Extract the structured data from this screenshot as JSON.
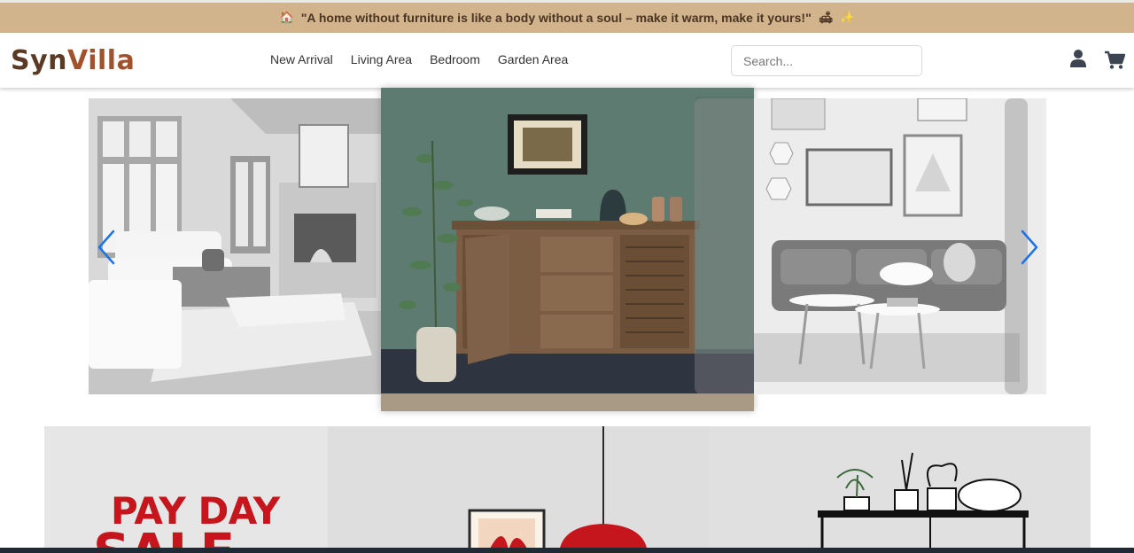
{
  "promo": {
    "house_emoji": "🏠",
    "text": "\"A home without furniture is like a body without a soul – make it warm, make it yours!\"",
    "couch_emoji": "🛋",
    "sparkle_emoji": "✨"
  },
  "brand": {
    "part1": "Syn",
    "part2": "Villa",
    "color_dark": "#5a3a25",
    "color_accent": "#a0522d"
  },
  "nav": {
    "items": [
      "New Arrival",
      "Living Area",
      "Bedroom",
      "Garden Area"
    ]
  },
  "search": {
    "placeholder": "Search...",
    "value": ""
  },
  "icons": {
    "user": "user-icon",
    "cart": "cart-icon",
    "prev": "chevron-left-icon",
    "next": "chevron-right-icon"
  },
  "carousel": {
    "slides": [
      "living-room-fireplace",
      "wooden-sideboard",
      "gallery-wall-lounge"
    ],
    "active_index": 1
  },
  "banner": {
    "line1": "PAY DAY",
    "line2": "SALE"
  },
  "colors": {
    "promo_bg": "#d2b48c",
    "arrow": "#1a73e8",
    "sale_red": "#c4161c"
  }
}
